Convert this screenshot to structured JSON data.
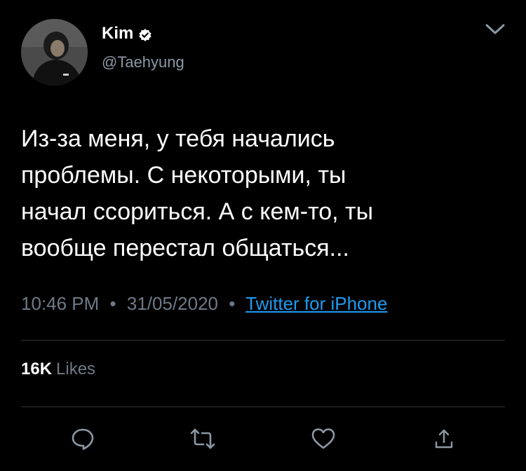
{
  "author": {
    "display_name": "Kim",
    "handle": "@Taehyung",
    "verified": true
  },
  "tweet": {
    "lines": [
      "Из-за меня, у тебя начались",
      "проблемы. С некоторыми, ты",
      "начал ссориться. А с кем-то, ты",
      "вообще перестал общаться..."
    ]
  },
  "meta": {
    "time": "10:46 PM",
    "separator": "•",
    "date": "31/05/2020",
    "source": "Twitter for iPhone"
  },
  "stats": {
    "likes_count": "16K",
    "likes_label": "Likes"
  },
  "icons": {
    "reply": "reply-icon",
    "retweet": "retweet-icon",
    "like": "heart-icon",
    "share": "share-icon",
    "more": "chevron-down-icon"
  },
  "colors": {
    "background": "#000000",
    "secondary_text": "#6e7a86",
    "link": "#1d9bf0",
    "divider": "#2f3336",
    "icon": "#8b98a5"
  }
}
